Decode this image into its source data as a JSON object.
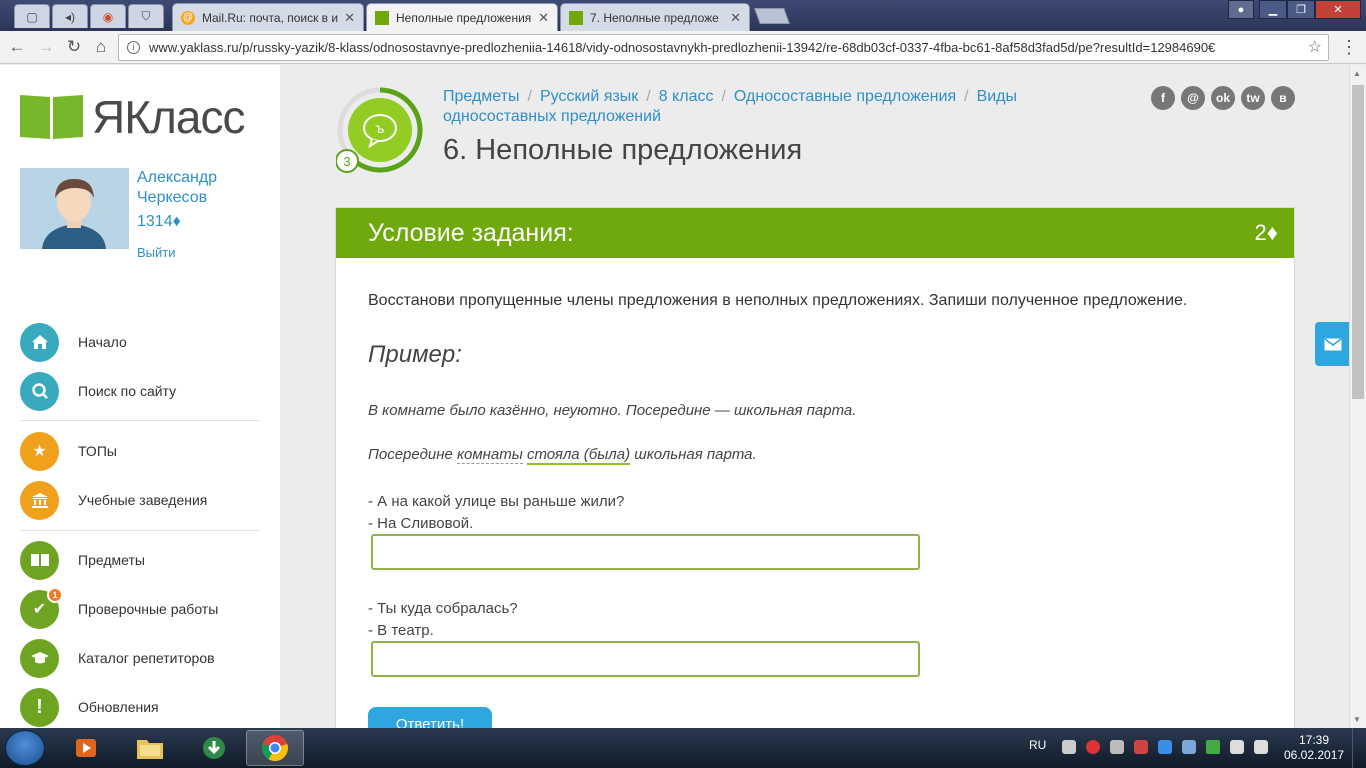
{
  "browser": {
    "tabs": [
      {
        "title": "Mail.Ru: почта, поиск в и",
        "icon": "mailru-icon",
        "active": false
      },
      {
        "title": "Неполные предложения",
        "icon": "yaklass-icon",
        "active": true
      },
      {
        "title": "7. Неполные предложе",
        "icon": "yaklass-icon",
        "active": false
      }
    ],
    "url": "www.yaklass.ru/p/russky-yazik/8-klass/odnosostavnye-predlozheniia-14618/vidy-odnosostavnykh-predlozhenii-13942/re-68db03cf-0337-4fba-bc61-8af58d3fad5d/pe?resultId=12984690€"
  },
  "sidebar": {
    "logo_text": "ЯКласс",
    "user_name": "Александр Черкесов",
    "user_points": "1314♦",
    "logout_label": "Выйти",
    "nav": [
      {
        "label": "Начало",
        "icon": "home-icon"
      },
      {
        "label": "Поиск по сайту",
        "icon": "search-icon"
      },
      {
        "label": "ТОПы",
        "icon": "star-icon"
      },
      {
        "label": "Учебные заведения",
        "icon": "building-icon"
      },
      {
        "label": "Предметы",
        "icon": "book-icon"
      },
      {
        "label": "Проверочные работы",
        "icon": "check-icon",
        "badge": "1"
      },
      {
        "label": "Каталог репетиторов",
        "icon": "graduation-cap-icon"
      },
      {
        "label": "Обновления",
        "icon": "exclamation-icon"
      }
    ]
  },
  "header": {
    "level": "3",
    "breadcrumbs": [
      "Предметы",
      "Русский язык",
      "8 класс",
      "Односоставные предложения",
      "Виды односоставных предложений"
    ],
    "title": "6. Неполные предложения",
    "social": [
      "f",
      "@",
      "ok",
      "tw",
      "в"
    ]
  },
  "task": {
    "header": "Условие задания:",
    "points": "2♦",
    "instruction": "Восстанови пропущенные члены предложения в неполных предложениях. Запиши полученное предложение.",
    "example_heading": "Пример:",
    "example_1": "В комнате было казённо, неуютно. Посередине — школьная парта.",
    "example_2_start": "Посередине ",
    "example_2_word1": "комнаты",
    "example_2_word2": "стояла (была)",
    "example_2_end": " школьная парта.",
    "q1_a": "- А на какой улице вы раньше жили?",
    "q1_b": "- На Сливовой.",
    "q2_a": "- Ты куда собралась?",
    "q2_b": "- В театр.",
    "answer_1": "",
    "answer_2": "",
    "submit_label": "Ответить!"
  },
  "taskbar": {
    "lang": "RU",
    "time": "17:39",
    "date": "06.02.2017"
  },
  "colors": {
    "brand_green": "#70a90b",
    "link_blue": "#2e8fc9",
    "button_blue": "#2ea6e0"
  }
}
